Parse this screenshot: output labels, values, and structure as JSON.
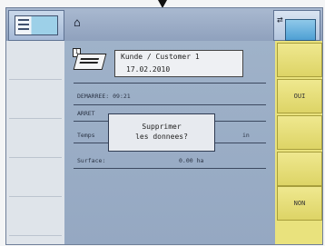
{
  "header": {
    "home_symbol": "⌂",
    "swap_symbol": "⇄",
    "icons": [
      "calendar-icon",
      "folder-icon"
    ]
  },
  "customer": {
    "index": "1",
    "name": "Kunde / Customer 1",
    "date": "17.02.2010"
  },
  "stats": {
    "row1_label": "DEMARREE:  09:21",
    "row2_label": "ARRET",
    "row3_label": "Temps",
    "row3_suffix": "in",
    "row4_label": "Surface:",
    "row4_value": "0.00 ha"
  },
  "dialog": {
    "line1": "Supprimer",
    "line2": "les donnees?"
  },
  "softkeys": {
    "yes": "OUI",
    "no": "NON"
  }
}
